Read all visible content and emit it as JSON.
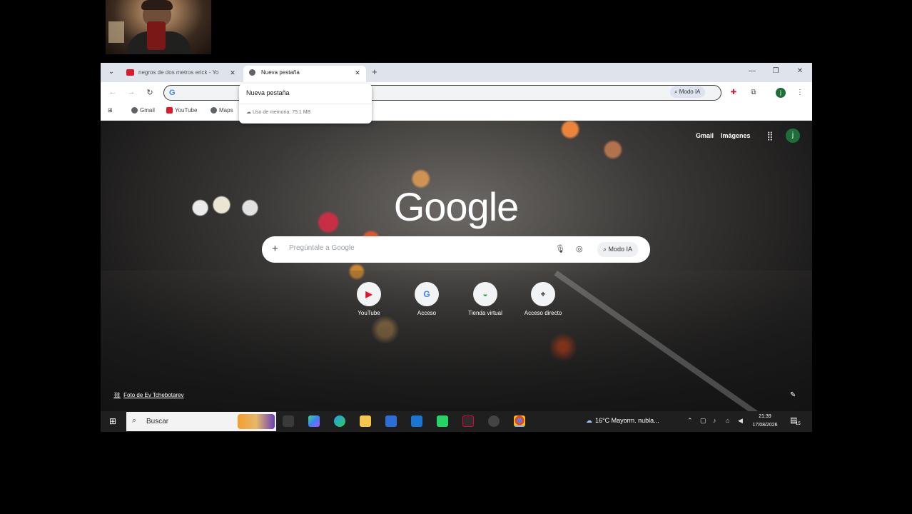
{
  "browser": {
    "tabs": [
      {
        "title": "negros de dos metros erick - Yo",
        "close": "✕"
      },
      {
        "title": "Nueva pestaña",
        "close": "✕"
      }
    ],
    "new_tab": "+",
    "tab_list": "⌄",
    "window_controls": {
      "minimize": "—",
      "restore": "❐",
      "close": "✕"
    },
    "omnibox": {
      "value": "",
      "modo_ia": "Modo IA"
    },
    "profile_initial": "j",
    "bookmarks": [
      "Gmail",
      "YouTube",
      "Maps"
    ],
    "hover_card": {
      "title": "Nueva pestaña",
      "memory": "Uso de memoria: 75.1 MB"
    }
  },
  "newtab": {
    "top_links": [
      "Gmail",
      "Imágenes"
    ],
    "profile_initial": "j",
    "logo": "Google",
    "search": {
      "placeholder": "Pregúntale a Google",
      "modo_ia": "Modo IA"
    },
    "shortcuts": [
      {
        "label": "YouTube",
        "glyph": "▶",
        "color": "#e0162b"
      },
      {
        "label": "Acceso",
        "glyph": "G",
        "color": "#4285f4"
      },
      {
        "label": "Tienda virtual",
        "glyph": "◒",
        "color": "#34a853"
      },
      {
        "label": "Acceso directo",
        "glyph": "+",
        "color": "#333333"
      }
    ],
    "photo_credit": "Foto de Ev Tchebotarev"
  },
  "taskbar": {
    "search_label": "Buscar",
    "weather": "16°C  Mayorm. nubla...",
    "time": "21:39",
    "date": "17/08/2026",
    "notification_count": "15"
  }
}
